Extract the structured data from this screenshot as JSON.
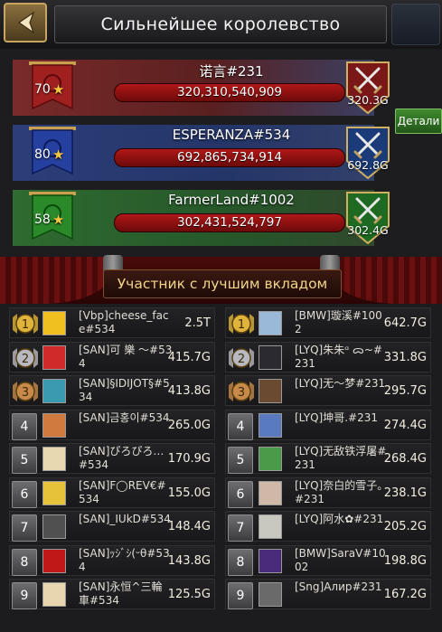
{
  "header": {
    "title": "Сильнейшее королевство"
  },
  "kingdoms": [
    {
      "name": "诺言#231",
      "score": "320,310,540,909",
      "level": "70",
      "power": "320.3G",
      "color": "#a02020",
      "theme": "red"
    },
    {
      "name": "ESPERANZA#534",
      "score": "692,865,734,914",
      "level": "80",
      "power": "692.8G",
      "color": "#2640a0",
      "theme": "blue"
    },
    {
      "name": "FarmerLand#1002",
      "score": "302,431,524,797",
      "level": "58",
      "power": "302.4G",
      "color": "#2a8a2a",
      "theme": "green"
    }
  ],
  "details_label": "Детали",
  "section_title": "Участник с лучшим вкладом",
  "left_list": [
    {
      "rank": "1",
      "name": "[Vbp]cheese_face#534",
      "value": "2.5T",
      "avatar": "#f0c020"
    },
    {
      "rank": "2",
      "name": "[SAN]可 樂 ～#534",
      "value": "415.7G",
      "avatar": "#d02a2a"
    },
    {
      "rank": "3",
      "name": "[SAN]§IDIJOT§#534",
      "value": "413.8G",
      "avatar": "#3a9ab0"
    },
    {
      "rank": "4",
      "name": "[SAN]금홍이#534",
      "value": "265.0G",
      "avatar": "#d07a40"
    },
    {
      "rank": "5",
      "name": "[SAN]ぴろぴろ…#534",
      "value": "170.9G",
      "avatar": "#e8d8b0"
    },
    {
      "rank": "6",
      "name": "[SAN]F◯REV€#534",
      "value": "155.0G",
      "avatar": "#e6c23a"
    },
    {
      "rank": "7",
      "name": "[SAN]_IUkD#534",
      "value": "148.4G",
      "avatar": "#505050"
    },
    {
      "rank": "8",
      "name": "[SAN]ｯｼﾞｼ(ᵕθ#534",
      "value": "143.8G",
      "avatar": "#c01818"
    },
    {
      "rank": "9",
      "name": "[SAN]永恒^三輪車#534",
      "value": "125.5G",
      "avatar": "#e8d6b0"
    }
  ],
  "right_list": [
    {
      "rank": "1",
      "name": "[BMW]璇溪#1002",
      "value": "642.7G",
      "avatar": "#9ab8d8"
    },
    {
      "rank": "2",
      "name": "[LYQ]朱朱ᵅ ᯅ~#231",
      "value": "331.8G",
      "avatar": "#2a2a30"
    },
    {
      "rank": "3",
      "name": "[LYQ]无～梦#231",
      "value": "295.7G",
      "avatar": "#6a4a30"
    },
    {
      "rank": "4",
      "name": "[LYQ]坤哥.#231",
      "value": "274.4G",
      "avatar": "#5a7ac0"
    },
    {
      "rank": "5",
      "name": "[LYQ]无敌铁浮屠#231",
      "value": "268.4G",
      "avatar": "#4a9a4a"
    },
    {
      "rank": "6",
      "name": "[LYQ]奈白的雪子。#231",
      "value": "238.1G",
      "avatar": "#d0b8a8"
    },
    {
      "rank": "7",
      "name": "[LYQ]阿水✿#231",
      "value": "205.2G",
      "avatar": "#c8c8c0"
    },
    {
      "rank": "8",
      "name": "[BMW]SaraV#1002",
      "value": "198.8G",
      "avatar": "#4a2a7a"
    },
    {
      "rank": "9",
      "name": "[Sng]Алир#231",
      "value": "167.2G",
      "avatar": "#6a6a6a"
    }
  ]
}
